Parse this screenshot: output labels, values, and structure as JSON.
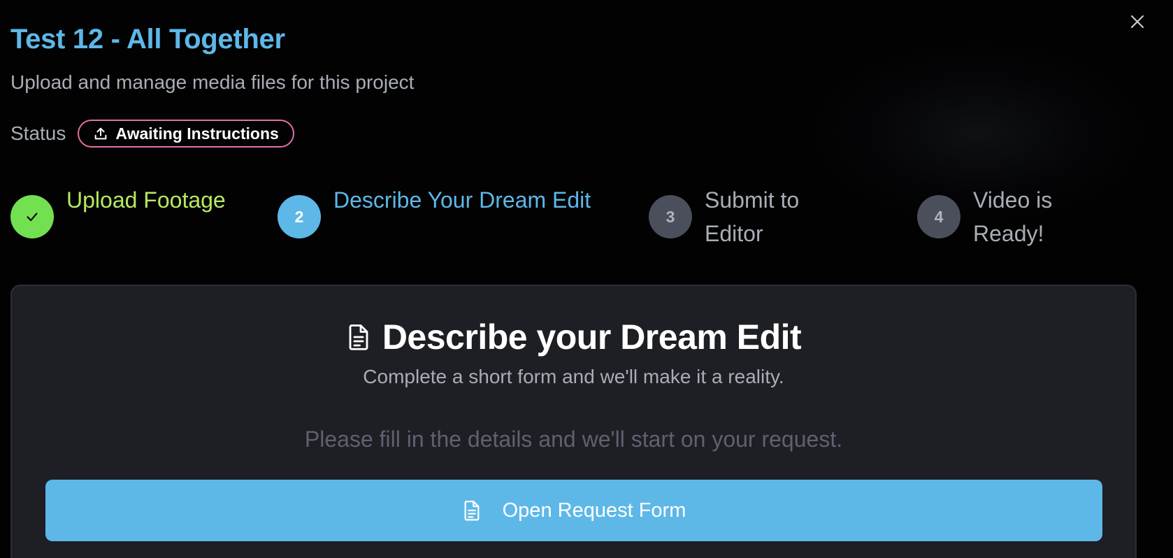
{
  "dialog": {
    "title": "Test 12 - All Together",
    "subtitle": "Upload and manage media files for this project",
    "close_icon": "close-icon"
  },
  "status": {
    "label": "Status",
    "value": "Awaiting Instructions",
    "icon": "upload-icon",
    "badge_color": "#e270a5"
  },
  "steps": [
    {
      "number": "1",
      "label": "Upload Footage",
      "state": "complete",
      "icon": "check-icon",
      "color": "#73e052"
    },
    {
      "number": "2",
      "label": "Describe Your Dream Edit",
      "state": "active",
      "color": "#5db8e8"
    },
    {
      "number": "3",
      "label": "Submit to Editor",
      "state": "pending",
      "color": "#4a4f5b"
    },
    {
      "number": "4",
      "label": "Video is Ready!",
      "state": "pending",
      "color": "#4a4f5b"
    }
  ],
  "card": {
    "heading": "Describe your Dream Edit",
    "heading_icon": "document-icon",
    "subheading": "Complete a short form and we'll make it a reality.",
    "hint": "Please fill in the details and we'll start on your request.",
    "button_label": "Open Request Form",
    "button_icon": "document-icon"
  },
  "colors": {
    "accent": "#5db8e8",
    "success": "#73e052",
    "background": "#020203",
    "card_background": "#1e1f24"
  }
}
